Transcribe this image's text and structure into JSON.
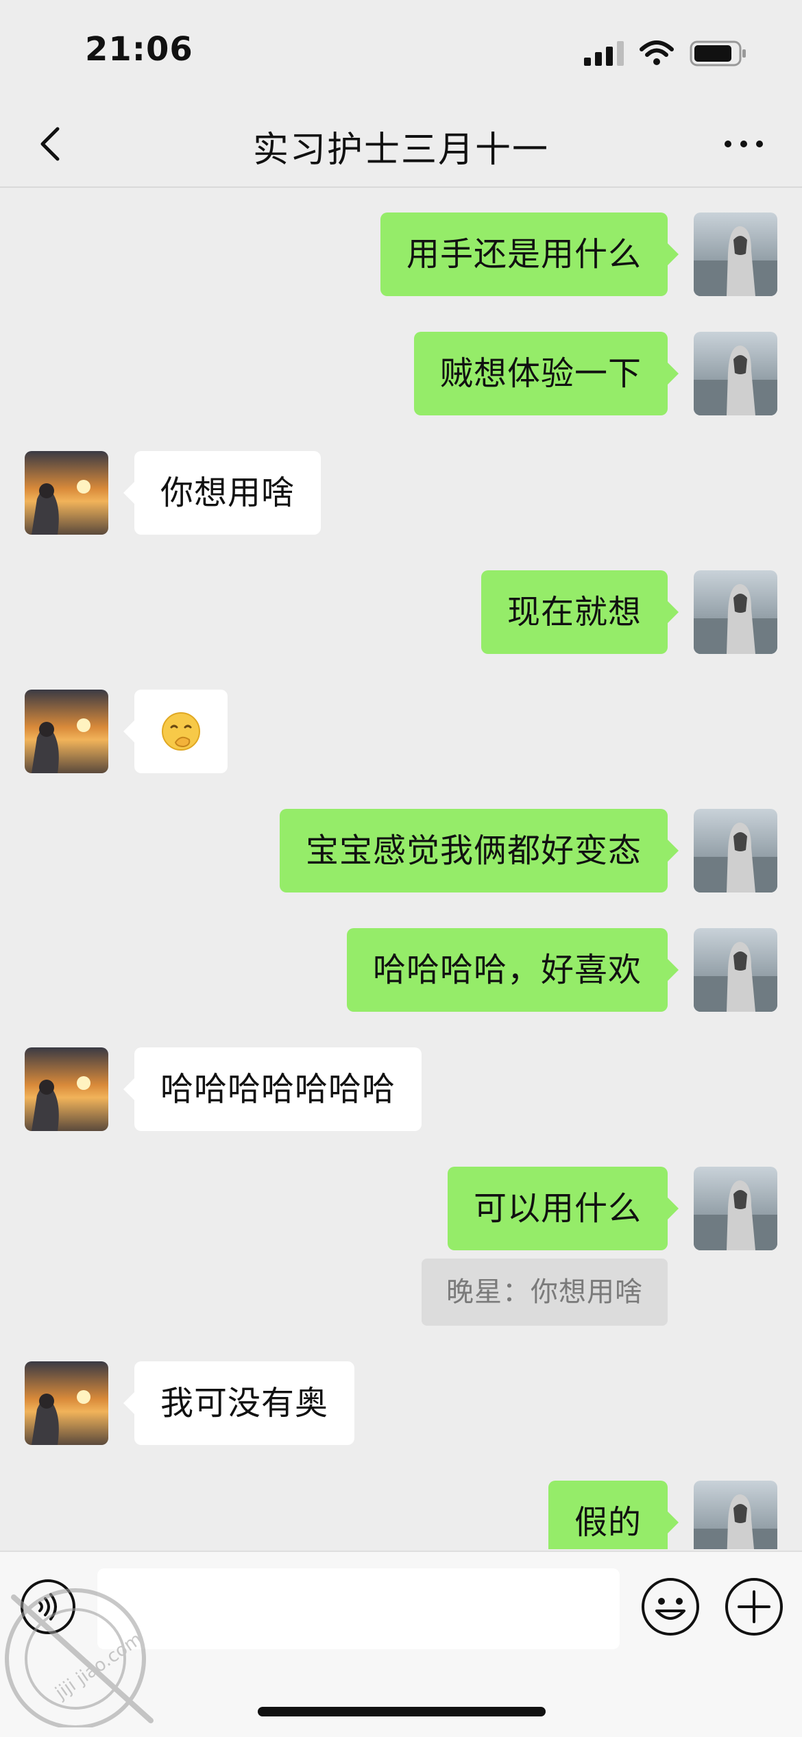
{
  "status": {
    "time": "21:06"
  },
  "nav": {
    "title": "实习护士三月十一"
  },
  "messages": [
    {
      "side": "me",
      "text": "用手还是用什么"
    },
    {
      "side": "me",
      "text": "贼想体验一下"
    },
    {
      "side": "peer",
      "text": "你想用啥"
    },
    {
      "side": "me",
      "text": "现在就想"
    },
    {
      "side": "peer",
      "emoji": "shushing-face-emoji"
    },
    {
      "side": "me",
      "text": "宝宝感觉我俩都好变态"
    },
    {
      "side": "me",
      "text": "哈哈哈哈，好喜欢"
    },
    {
      "side": "peer",
      "text": "哈哈哈哈哈哈哈"
    },
    {
      "side": "me",
      "text": "可以用什么"
    },
    {
      "quote": "晚星：你想用啥"
    },
    {
      "side": "peer",
      "text": "我可没有奥"
    },
    {
      "side": "me",
      "text": "假的"
    }
  ],
  "input_bar": {
    "placeholder": ""
  },
  "icons": {
    "back": "chevron-left-icon",
    "more": "more-dots-icon",
    "voice": "voice-icon",
    "emoji": "emoji-icon",
    "add": "plus-circle-icon"
  },
  "colors": {
    "background": "#ededed",
    "my_bubble": "#95ec69",
    "peer_bubble": "#ffffff",
    "quote_bg": "#dcdcdc"
  },
  "watermark_text": "jiji jiao.com"
}
